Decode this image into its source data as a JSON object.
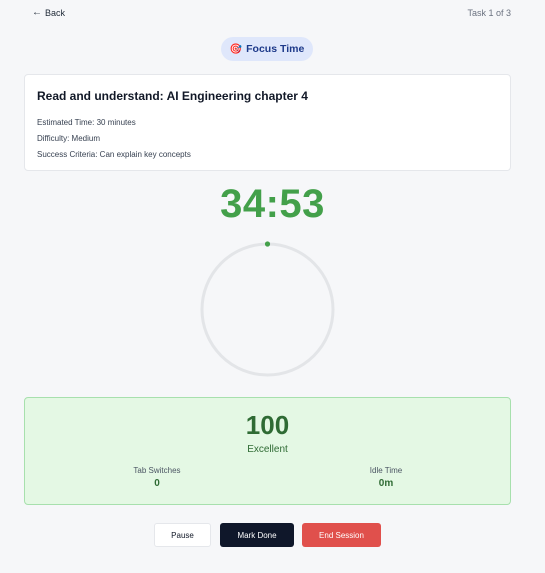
{
  "topbar": {
    "back_label": "Back",
    "progress_text": "Task 1 of 3"
  },
  "mode": {
    "label": "Focus Time",
    "icon": "target-dart-icon"
  },
  "task": {
    "title": "Read and understand: AI Engineering chapter 4",
    "estimated_time": "Estimated Time: 30 minutes",
    "difficulty": "Difficulty: Medium",
    "success_criteria": "Success Criteria: Can explain key concepts"
  },
  "timer": {
    "display": "34:53",
    "remaining_fraction": 1.0,
    "color": "#43a04a"
  },
  "score": {
    "value": "100",
    "label": "Excellent",
    "tab_switches_label": "Tab Switches",
    "tab_switches_value": "0",
    "idle_time_label": "Idle Time",
    "idle_time_value": "0m"
  },
  "actions": {
    "pause": "Pause",
    "mark_done": "Mark Done",
    "end_session": "End Session"
  },
  "colors": {
    "accent_green": "#43a04a",
    "danger": "#e0504c",
    "dark": "#0f172a",
    "badge_bg": "#dfe7fb"
  }
}
